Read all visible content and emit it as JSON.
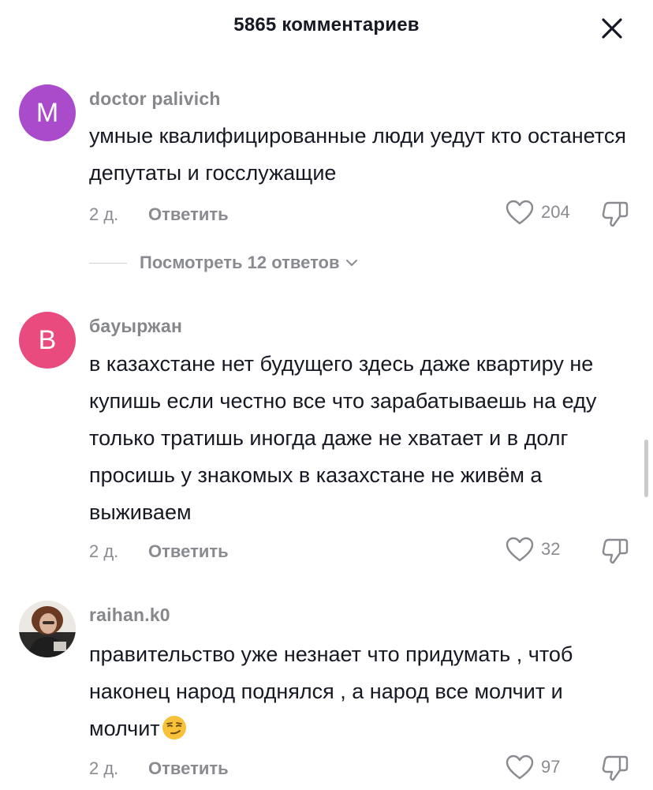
{
  "header": {
    "title": "5865 комментариев",
    "close_icon": "close-icon"
  },
  "comments": [
    {
      "avatar_letter": "M",
      "avatar_color": "#a94bcb",
      "username": "doctor palivich",
      "text": "умные квалифицированные люди уедут кто останется депутаты и госслужащие",
      "date": "2 д.",
      "reply_label": "Ответить",
      "likes": "204",
      "replies_label": "Посмотреть 12 ответов"
    },
    {
      "avatar_letter": "B",
      "avatar_color": "#e94b7e",
      "username": "бауыржан",
      "text": "в казахстане нет будущего здесь даже квартиру не купишь если честно все что зарабатываешь на еду только тратишь иногда даже не хватает и в долг просишь у знакомых в казахстане не живём а выживаем",
      "date": "2 д.",
      "reply_label": "Ответить",
      "likes": "32"
    },
    {
      "avatar_icon": "user-photo",
      "username": "raihan.k0",
      "text": "правительство уже незнает что придумать , чтоб наконец народ поднялся , а народ все молчит и молчит",
      "emoji": "smirking-face-emoji",
      "date": "2 д.",
      "reply_label": "Ответить",
      "likes": "97"
    }
  ],
  "colors": {
    "text_primary": "#161823",
    "text_secondary": "#8a8b91"
  }
}
